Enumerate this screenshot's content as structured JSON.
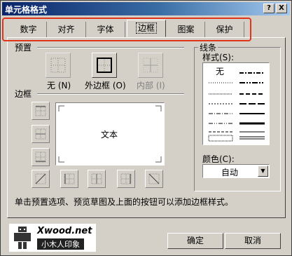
{
  "window": {
    "title": "单元格格式",
    "help_label": "?",
    "close_label": "X"
  },
  "tabs": [
    {
      "label": "数字"
    },
    {
      "label": "对齐"
    },
    {
      "label": "字体"
    },
    {
      "label": "边框",
      "active": true
    },
    {
      "label": "图案"
    },
    {
      "label": "保护"
    }
  ],
  "preset": {
    "section_label": "预置",
    "buttons": [
      {
        "label": "无 (N)",
        "icon": "border-none-icon"
      },
      {
        "label": "外边框 (O)",
        "icon": "border-outline-icon"
      },
      {
        "label": "内部 (I)",
        "icon": "border-inside-icon",
        "disabled": true
      }
    ]
  },
  "border": {
    "section_label": "边框",
    "preview_text": "文本"
  },
  "line": {
    "section_label": "线条",
    "style_label": "样式(S):",
    "none_label": "无",
    "color_label": "颜色(C):",
    "color_value": "自动"
  },
  "hint": "单击预置选项、预览草图及上面的按钮可以添加边框样式。",
  "logo": {
    "brand": "Xwood.net",
    "subtitle": "小木人印象"
  },
  "buttons": {
    "ok": "确定",
    "cancel": "取消"
  },
  "colors": {
    "title_start": "#0a246a",
    "title_end": "#a6caf0",
    "highlight": "#e0341d",
    "face": "#d4d0c8"
  }
}
